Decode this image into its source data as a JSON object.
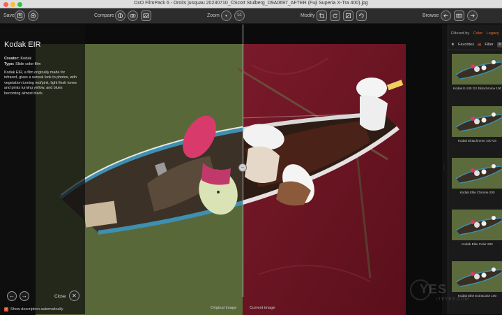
{
  "window": {
    "title": "DxO FilmPack 6 - Droits jusquau 20230710_©Scott Stulberg_D9A0697_AFTER (Fuji Superia X-Tra 400).jpg"
  },
  "toolbar": {
    "save_label": "Save",
    "compare_label": "Compare",
    "zoom_label": "Zoom",
    "zoom_fit_label": "1:1",
    "modify_label": "Modify",
    "browse_label": "Browse"
  },
  "description": {
    "title": "Kodak EIR",
    "creator_key": "Creator:",
    "creator_value": "Kodak",
    "type_key": "Type:",
    "type_value": "Slide color film",
    "body": "Kodak EIR, a film originally made for infrared, gives a surreal look to photos, with vegetation turning red/pink, light flesh tones and pinks turning yellow, and blues becoming almost black.",
    "close_label": "Close",
    "auto_label": "Show description automatically",
    "auto_checked": true
  },
  "viewer": {
    "original_label": "Original image",
    "current_label": "Current image"
  },
  "sidebar": {
    "filtered_by_label": "Filtered by",
    "filter_color": "Color",
    "filter_legacy": "Legacy",
    "favorites_label": "Favorites",
    "filter_label": "Filter",
    "thumbnails": [
      {
        "label": "Kodak E-100 GX Ektachrome 100"
      },
      {
        "label": "Kodak Ektachrome 100 VS"
      },
      {
        "label": "Kodak Elite Chrome 200"
      },
      {
        "label": "Kodak Elite Color 200"
      },
      {
        "label": "Kodak Elite ExtraColor 100"
      }
    ]
  },
  "colors": {
    "accent": "#e46a2c",
    "water_original": "#5b6a3a",
    "water_current": "#6b1523"
  },
  "watermark": {
    "big": "YES",
    "small": "ITEYES.COM"
  }
}
